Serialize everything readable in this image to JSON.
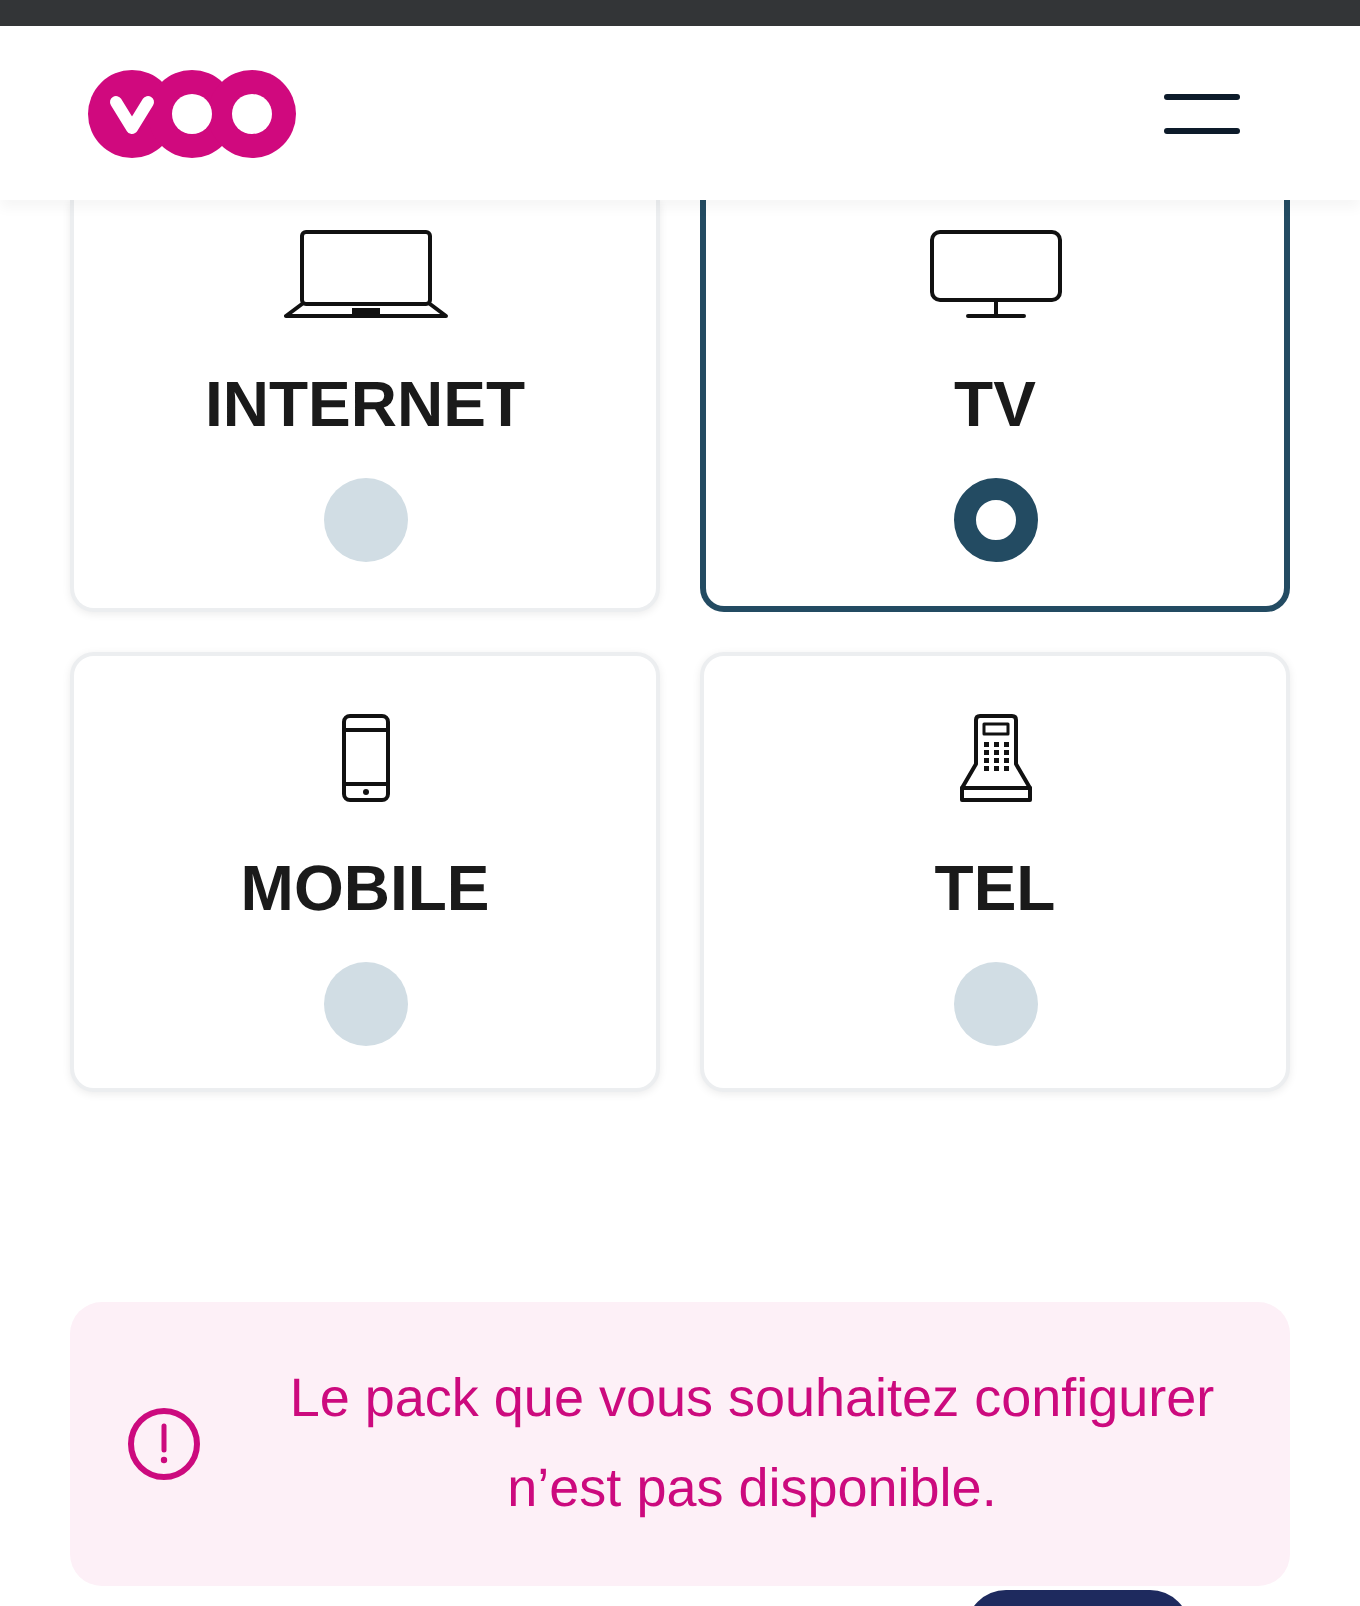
{
  "products": [
    {
      "kind": "laptop",
      "label": "INTERNET",
      "selected": false
    },
    {
      "kind": "tv",
      "label": "TV",
      "selected": true
    },
    {
      "kind": "mobile",
      "label": "MOBILE",
      "selected": false
    },
    {
      "kind": "phone",
      "label": "TEL",
      "selected": false
    }
  ],
  "alert": {
    "message": "Le pack que vous souhaitez configurer n’est pas disponible."
  }
}
